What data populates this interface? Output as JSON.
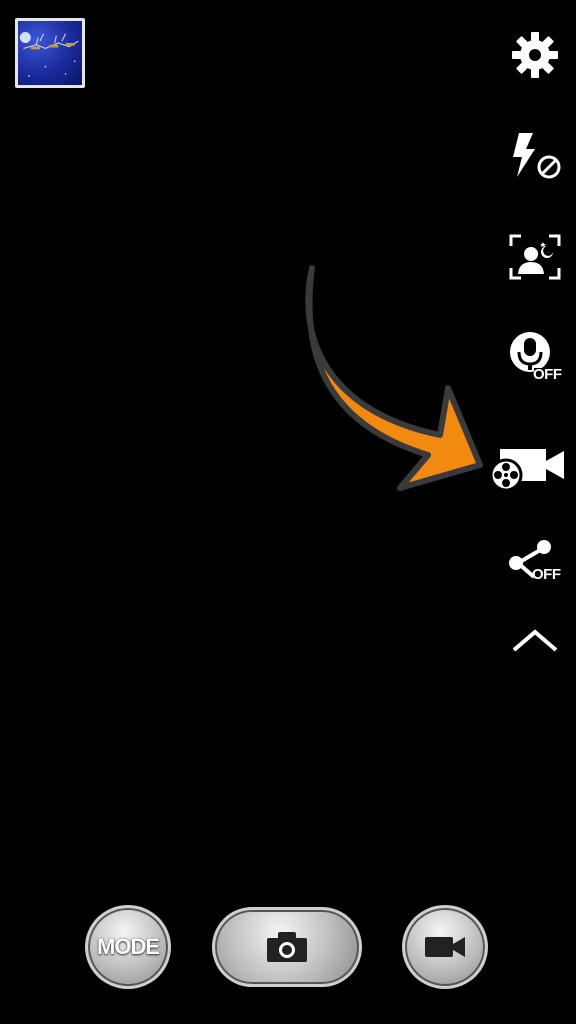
{
  "gallery": {
    "thumbnail_icon": "gallery-thumbnail"
  },
  "side_menu": [
    {
      "name": "settings-icon",
      "label": ""
    },
    {
      "name": "flash-off-icon",
      "label": ""
    },
    {
      "name": "face-detection-icon",
      "label": ""
    },
    {
      "name": "voice-control-off-icon",
      "label": "OFF"
    },
    {
      "name": "video-recording-mode-icon",
      "label": ""
    },
    {
      "name": "share-off-icon",
      "label": "OFF"
    },
    {
      "name": "expand-up-icon",
      "label": ""
    }
  ],
  "annotation": {
    "arrow_color": "#f28a12",
    "arrow_outline": "#3a3a3a"
  },
  "bottom_bar": {
    "mode_label": "MODE",
    "shutter_icon": "camera-icon",
    "record_icon": "video-camera-icon"
  }
}
